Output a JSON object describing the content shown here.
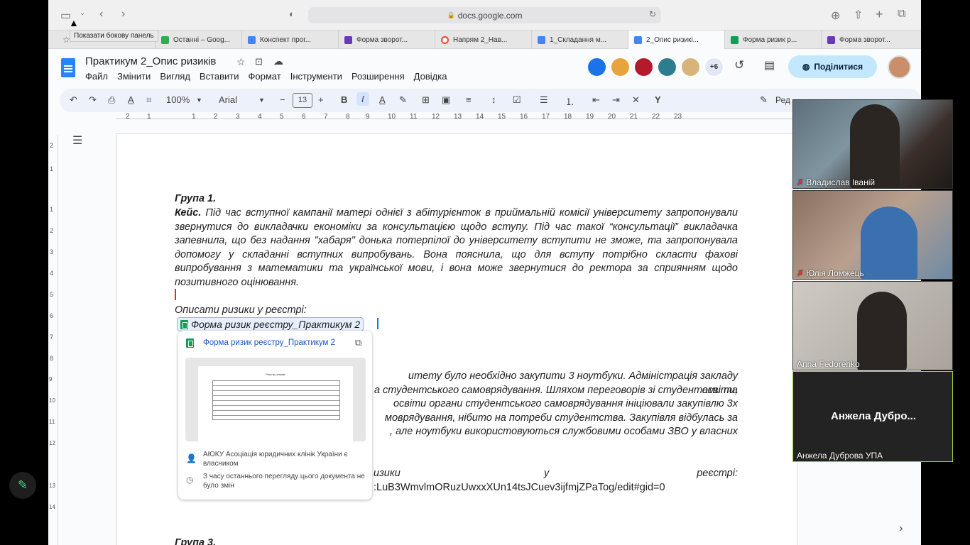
{
  "safari": {
    "url": "docs.google.com",
    "tooltip": "Показати бокову панель"
  },
  "tabs": [
    {
      "label": "Останні – Goog...",
      "color": "#4285f4"
    },
    {
      "label": "Конспект прог...",
      "color": "#4285f4"
    },
    {
      "label": "Форма зворот...",
      "color": "#673ab7"
    },
    {
      "label": "Напрям 2_Нав...",
      "color": "#ea4335"
    },
    {
      "label": "1_Складання м...",
      "color": "#4285f4"
    },
    {
      "label": "2_Опис ризикі...",
      "color": "#4285f4"
    },
    {
      "label": "Форма ризик р...",
      "color": "#0f9d58"
    },
    {
      "label": "Форма зворот...",
      "color": "#673ab7"
    }
  ],
  "doc": {
    "title": "Практикум 2_Опис ризиків",
    "menu": [
      "Файл",
      "Змінити",
      "Вигляд",
      "Вставити",
      "Формат",
      "Інструменти",
      "Розширення",
      "Довідка"
    ],
    "share_label": "Поділитися",
    "extra_collaborators": "+6"
  },
  "toolbar": {
    "zoom": "100%",
    "font": "Arial",
    "font_size": "13",
    "edit_mode": "Ред"
  },
  "ruler": [
    "2",
    "1",
    "1",
    "2",
    "3",
    "4",
    "5",
    "6",
    "7",
    "8",
    "9",
    "10",
    "11",
    "12",
    "13",
    "14",
    "15",
    "16",
    "17",
    "18",
    "19",
    "20",
    "21",
    "22",
    "23"
  ],
  "vruler": [
    "2",
    "1",
    "1",
    "2",
    "3",
    "4",
    "5",
    "6",
    "7",
    "8",
    "9",
    "10",
    "11",
    "12",
    "13",
    "14"
  ],
  "content": {
    "group1": "Група 1.",
    "case_label": "Кейс.",
    "case_text": " Під час вступної кампанії матері однієї з абітурієнток в приймальній комісії університету запропонували звернутися до викладачки економіки за консультацією щодо вступу. Під час такої “консультації” викладачка запевнила, що без надання \"хабаря\" донька потерпілої до університету вступити не зможе, та запропонувала допомогу у складанні вступних випробувань. Вона пояснила, що для вступу потрібно скласти фахові випробування з математики та української мови, і вона може звернутися до ректора за сприянням щодо позитивного оцінювання.",
    "describe": "Описати ризики у реєстрі:",
    "chip_label": "Форма ризик реєстру_Практикум 2",
    "case2_l1": "итету було необхідно закупити 3 ноутбуки. Адміністрація закладу освіти,",
    "case2_l2": "а студентського самоврядування. Шляхом переговорів зі студентами та",
    "case2_l3": "освіти органи студентського самоврядування ініціювали закупівлю 3х",
    "case2_l4": "моврядування, нібито на потреби студентства. Закупівля відбулась за",
    "case2_l5": ", але ноутбуки використовуються службовими особами ЗВО у власних",
    "risks_mid": "изики",
    "risks_u": "у",
    "risks_end": "реєстрі:",
    "link_tail": ":LuB3WmvlmORuzUwxxXUn14tsJCuev3ijfmjZPaTog/edit#gid=0",
    "group3": "Група 3."
  },
  "card": {
    "title": "Форма ризик реєстру_Практикум 2",
    "owner": "АЮКУ Асоціація юридичних клінік України є власником",
    "changes": "З часу останнього перегляду цього документа не було змін",
    "thumb_title": "Реєстр ризиків"
  },
  "video": [
    {
      "name": "Владислав Іваній",
      "muted": true
    },
    {
      "name": "Юлія Ломжець",
      "muted": true
    },
    {
      "name": "Anna Fedorenko",
      "muted": false
    },
    {
      "name": "Анжела Дубро...",
      "label": "Анжела Дуброва УПА",
      "muted": false
    }
  ]
}
